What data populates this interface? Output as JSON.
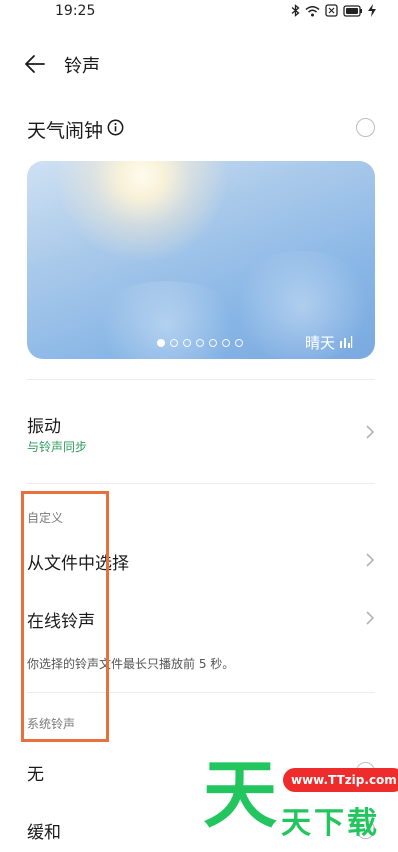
{
  "status_bar": {
    "time": "19:25",
    "icons": [
      "bluetooth-icon",
      "wifi-icon",
      "sim-icon",
      "battery-icon",
      "charging-icon"
    ]
  },
  "header": {
    "back_icon": "arrow-left-icon",
    "title": "铃声"
  },
  "weather_alarm": {
    "label": "天气闹钟",
    "info_icon": "info-icon",
    "selected": false,
    "card": {
      "condition": "晴天",
      "signal_icon": "signal-bars-icon",
      "dots_total": 7,
      "active_dot": 0
    }
  },
  "vibration": {
    "title": "振动",
    "subtitle": "与铃声同步"
  },
  "custom_section": {
    "header": "自定义",
    "items": [
      {
        "label": "从文件中选择"
      },
      {
        "label": "在线铃声"
      }
    ],
    "note": "你选择的铃声文件最长只播放前 5 秒。"
  },
  "system_section": {
    "header": "系统铃声",
    "items": [
      {
        "label": "无"
      },
      {
        "label": "缓和"
      }
    ]
  },
  "watermark": {
    "big_char": "天",
    "url": "www.TTzip.com",
    "text": "天下载"
  },
  "colors": {
    "accent_green": "#2f9e5c",
    "highlight_orange": "#e8703c",
    "watermark_green": "#22c55e",
    "watermark_red": "#ef2c2c"
  }
}
